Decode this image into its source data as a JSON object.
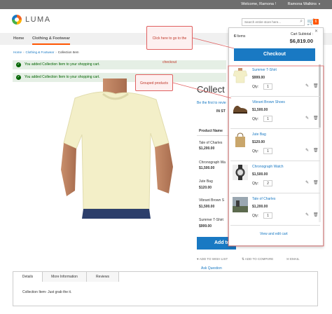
{
  "header": {
    "welcome": "Welcome, Ramona !",
    "account_name": "Ramona Walkins",
    "logo_text": "LUMA",
    "search_placeholder": "Search entire store here...",
    "cart_count": "6"
  },
  "nav": {
    "items": [
      {
        "label": "Home"
      },
      {
        "label": "Clothing & Footwear"
      }
    ]
  },
  "breadcrumbs": [
    "Home",
    "Clothing & Footwear",
    "Collection Item"
  ],
  "messages": [
    "You added Collection Item to your shopping cart.",
    "You added Collection Item to your shopping cart."
  ],
  "product": {
    "title": "Collect",
    "review_link": "Be the first to revie",
    "stock": "IN ST",
    "grouped_header": "Product Name",
    "grouped_items": [
      {
        "name": "Tale of Charles",
        "price": "$1,200.00"
      },
      {
        "name": "Chronograph Wa",
        "price": "$1,500.00"
      },
      {
        "name": "Jute Bag",
        "price": "$120.00"
      },
      {
        "name": "Vibrant Brown S",
        "price": "$1,500.00"
      },
      {
        "name": "Summer T-Shirt",
        "price": "$999.00"
      }
    ],
    "add_to_cart": "Add to",
    "wishlist": "ADD TO WISH LIST",
    "compare": "ADD TO COMPARE",
    "email": "EMAIL",
    "ask": "Ask Question"
  },
  "tabs": {
    "items": [
      "Details",
      "More Information",
      "Reviews"
    ],
    "content": "Collection Item- Just grab the it."
  },
  "minicart": {
    "items_count": "6",
    "items_label": "Items",
    "subtotal_label": "Cart Subtotal :",
    "subtotal": "$6,819.00",
    "checkout": "Checkout",
    "qty_label": "Qty:",
    "items": [
      {
        "name": "Summer T-Shirt",
        "price": "$999.00",
        "qty": "1"
      },
      {
        "name": "Vibrant Brown Shoes",
        "price": "$1,500.00",
        "qty": "1"
      },
      {
        "name": "Jute Bag",
        "price": "$120.00",
        "qty": "1"
      },
      {
        "name": "Chronograph Watch",
        "price": "$1,500.00",
        "qty": "2"
      },
      {
        "name": "Tale of Charles",
        "price": "$1,200.00",
        "qty": "1"
      }
    ],
    "view_edit": "View and edit cart"
  },
  "callouts": {
    "checkout": "Click here to go to the checkout",
    "grouped": "Grouped products"
  },
  "colors": {
    "accent": "#1979c3",
    "badge": "#ff5501",
    "callout": "#e06060",
    "success_bg": "#e5efe5"
  }
}
